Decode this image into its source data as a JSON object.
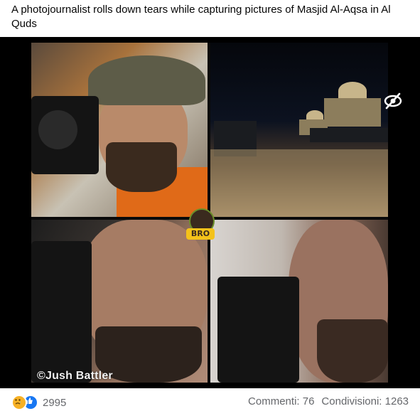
{
  "post": {
    "text": "A photojournalist rolls down tears while capturing pictures of Masjid Al-Aqsa in Al Quds"
  },
  "media": {
    "watermark": "©Jush Battler",
    "badge_label": "BRO",
    "hide_icon": "eye-slash-icon"
  },
  "footer": {
    "reaction_icons": [
      "sad-reaction-icon",
      "like-reaction-icon"
    ],
    "reaction_count": "2995",
    "comments_label": "Commenti: 76",
    "shares_label": "Condivisioni: 1263"
  },
  "colors": {
    "like_blue": "#1877f2",
    "sad_yellow": "#f7b125",
    "meta_gray": "#65676b"
  }
}
